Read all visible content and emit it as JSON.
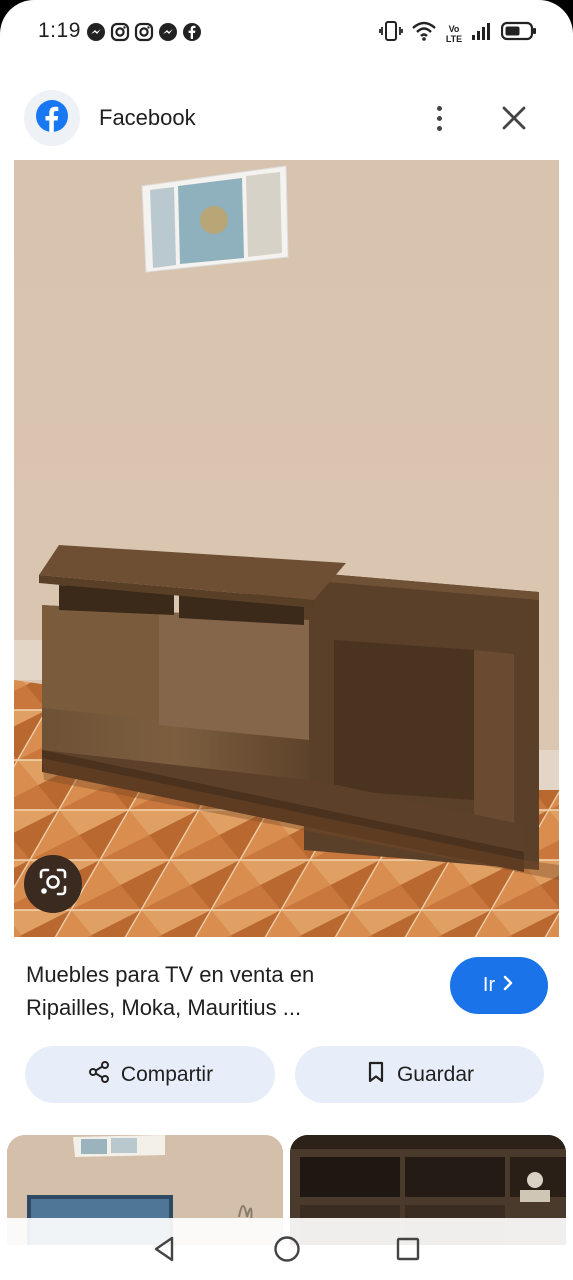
{
  "status_bar": {
    "time": "1:19",
    "network_label": "Vo LTE"
  },
  "header": {
    "site_name": "Facebook"
  },
  "result": {
    "title": "Muebles para TV en venta en Ripailles, Moka, Mauritius ...",
    "go_label": "Ir"
  },
  "actions": {
    "share_label": "Compartir",
    "save_label": "Guardar"
  },
  "colors": {
    "accent": "#1a73e8",
    "pill_bg": "#e8eef9",
    "facebook_blue": "#1877f2"
  },
  "icons": {
    "notifications": [
      "messenger-icon",
      "instagram-icon",
      "instagram-icon",
      "messenger-icon",
      "facebook-icon"
    ],
    "system": [
      "vibrate-icon",
      "wifi-icon",
      "volte-icon",
      "signal-icon",
      "battery-icon"
    ]
  }
}
